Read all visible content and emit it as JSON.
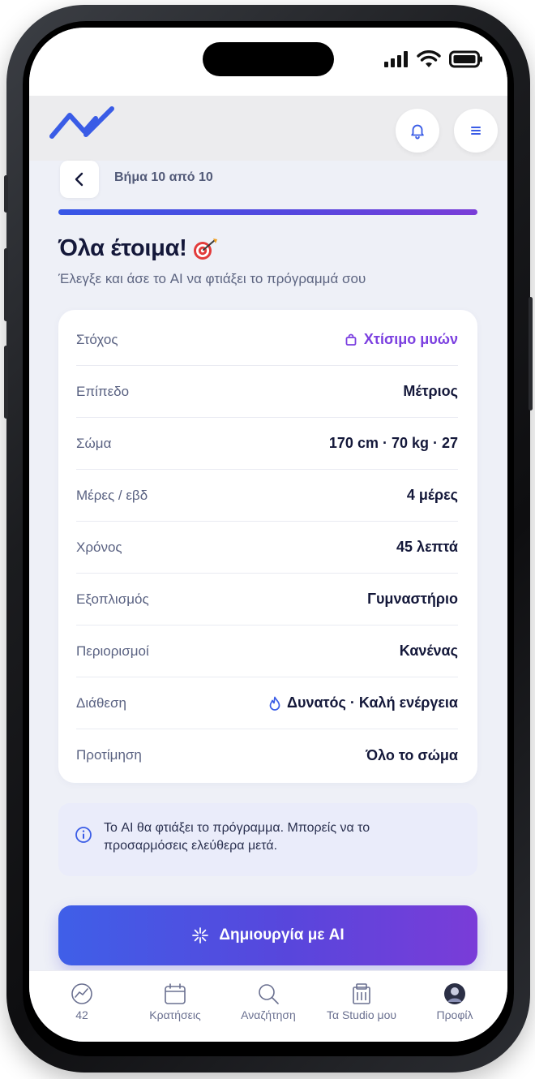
{
  "header": {
    "notifications_icon": "bell-icon",
    "menu_icon": "menu-icon",
    "logo_icon": "zigzag-logo-icon"
  },
  "step": {
    "label": "Βήμα 10 από 10"
  },
  "title": "Όλα έτοιμα!",
  "title_emoji": "🎯",
  "subtitle": "Έλεγξε και άσε το AI να φτιάξει το πρόγραμμά σου",
  "summary": {
    "rows": [
      {
        "label": "Στόχος",
        "value": "Χτίσιμο μυών",
        "icon": "shopping-bag-icon",
        "accent": true
      },
      {
        "label": "Επίπεδο",
        "value": "Μέτριος"
      },
      {
        "label": "Σώμα",
        "value": "170 cm · 70 kg · 27"
      },
      {
        "label": "Μέρες / εβδ",
        "value": "4 μέρες"
      },
      {
        "label": "Χρόνος",
        "value": "45 λεπτά"
      },
      {
        "label": "Εξοπλισμός",
        "value": "Γυμναστήριο"
      },
      {
        "label": "Περιορισμοί",
        "value": "Κανένας"
      },
      {
        "label": "Διάθεση",
        "value": "Δυνατός · Καλή ενέργεια",
        "icon": "flame-icon"
      },
      {
        "label": "Προτίμηση",
        "value": "Όλο το σώμα"
      }
    ]
  },
  "info": {
    "line1": "Το AI θα φτιάξει το πρόγραμμα. Μπορείς να το",
    "line2": "προσαρμόσεις ελεύθερα μετά."
  },
  "cta": {
    "label": "Δημιουργία με AI"
  },
  "tabbar": {
    "tabs": [
      {
        "label": "42",
        "icon": "score-gauge-icon"
      },
      {
        "label": "Κρατήσεις",
        "icon": "calendar-icon"
      },
      {
        "label": "Αναζήτηση",
        "icon": "search-icon"
      },
      {
        "label": "Τα Studio μου",
        "icon": "building-icon"
      },
      {
        "label": "Προφίλ",
        "icon": "avatar"
      }
    ]
  },
  "colors": {
    "accent": "#7b3fe0",
    "primary": "#3f5fe8",
    "text": "#14183a",
    "muted": "#5a6282"
  }
}
